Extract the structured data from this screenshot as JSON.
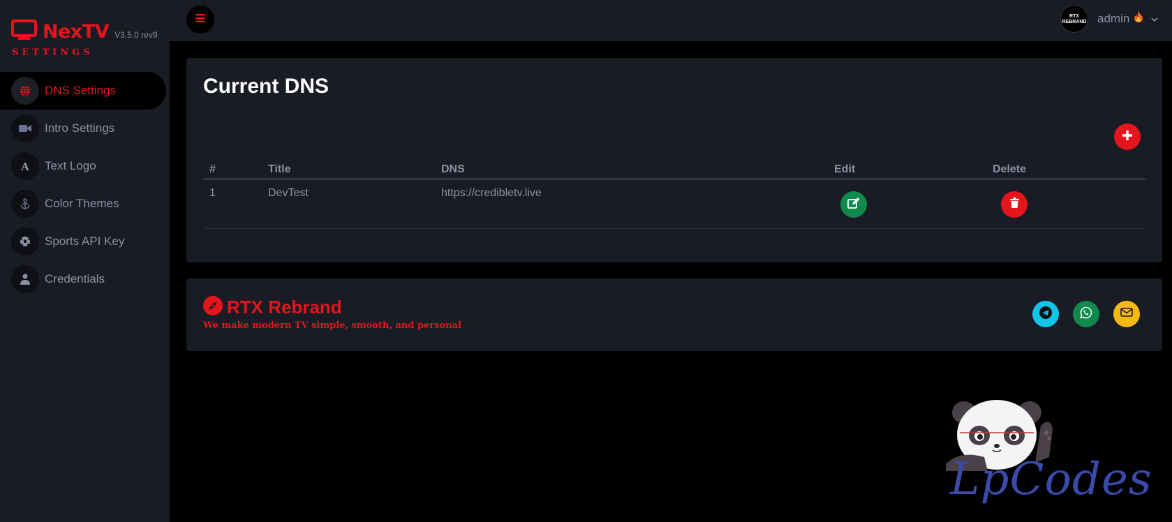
{
  "app": {
    "name": "NexTV",
    "version": "V3.5.0 rev9",
    "subtitle": "SETTINGS",
    "accent_color": "#e5151c"
  },
  "sidebar": {
    "items": [
      {
        "label": "DNS Settings",
        "icon": "globe-icon",
        "active": true
      },
      {
        "label": "Intro Settings",
        "icon": "video-camera-icon",
        "active": false
      },
      {
        "label": "Text Logo",
        "icon": "letter-a-icon",
        "active": false
      },
      {
        "label": "Color Themes",
        "icon": "anchor-icon",
        "active": false
      },
      {
        "label": "Sports API Key",
        "icon": "soccer-ball-icon",
        "active": false
      },
      {
        "label": "Credentials",
        "icon": "user-icon",
        "active": false
      }
    ]
  },
  "topbar": {
    "menu_icon": "hamburger-icon",
    "avatar_text_line1": "RTX",
    "avatar_text_line2": "REBRAND",
    "username": "admin",
    "user_icon": "fire-icon"
  },
  "dns": {
    "title": "Current DNS",
    "add_icon": "plus-icon",
    "headers": {
      "num": "#",
      "title": "Title",
      "dns": "DNS",
      "edit": "Edit",
      "delete": "Delete"
    },
    "rows": [
      {
        "num": "1",
        "title": "DevTest",
        "dns": "https://credibletv.live"
      }
    ]
  },
  "footer": {
    "brand": "RTX Rebrand",
    "brand_icon": "compass-icon",
    "tagline": "We make modern TV simple, smooth, and personal",
    "social": [
      {
        "name": "telegram-icon",
        "color": "#11c5e8"
      },
      {
        "name": "whatsapp-icon",
        "color": "#0f8a4c"
      },
      {
        "name": "email-icon",
        "color": "#f5b90f"
      }
    ]
  },
  "watermark": {
    "text": "LpCodes"
  }
}
